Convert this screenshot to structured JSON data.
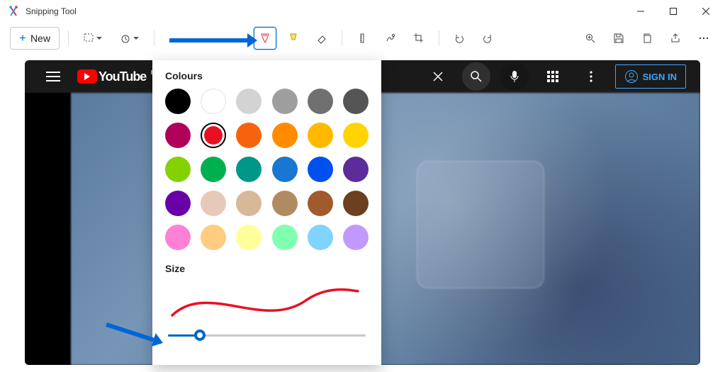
{
  "app": {
    "title": "Snipping Tool"
  },
  "toolbar": {
    "new_label": "New",
    "selected_tool": "pen"
  },
  "popup": {
    "colours_heading": "Colours",
    "size_heading": "Size",
    "selected_color": "#e81123",
    "preview_stroke_color": "#e81123",
    "slider_value_pct": 17,
    "colors": [
      "#000000",
      "#ffffff",
      "#d3d3d3",
      "#9e9e9e",
      "#707070",
      "#555555",
      "#b0005a",
      "#e81123",
      "#f7630c",
      "#ff8c00",
      "#ffb900",
      "#ffd400",
      "#84d100",
      "#00b050",
      "#009688",
      "#1976d2",
      "#0050ef",
      "#5b2c9a",
      "#6a00a8",
      "#e6c9b8",
      "#d7b899",
      "#b08b5f",
      "#a05a2c",
      "#6b3f1f",
      "#ff80d4",
      "#ffcc80",
      "#ffff99",
      "#80ffb0",
      "#80d4ff",
      "#c299ff"
    ]
  },
  "youtube": {
    "brand": "YouTube",
    "region": "IN",
    "signin_label": "SIGN IN"
  }
}
